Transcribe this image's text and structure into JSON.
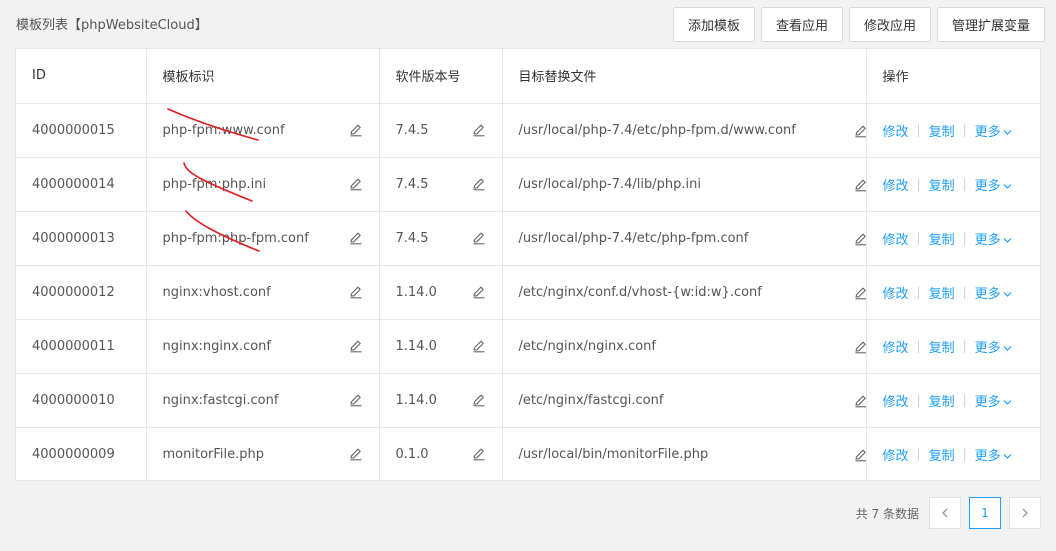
{
  "page": {
    "title": "模板列表【phpWebsiteCloud】"
  },
  "toolbar": {
    "add_template": "添加模板",
    "view_app": "查看应用",
    "edit_app": "修改应用",
    "manage_vars": "管理扩展变量"
  },
  "table": {
    "headers": {
      "id": "ID",
      "template": "模板标识",
      "version": "软件版本号",
      "target_file": "目标替换文件",
      "actions": "操作"
    },
    "rows": [
      {
        "id": "4000000015",
        "template": "php-fpm:www.conf",
        "version": "7.4.5",
        "target_file": "/usr/local/php-7.4/etc/php-fpm.d/www.conf"
      },
      {
        "id": "4000000014",
        "template": "php-fpm:php.ini",
        "version": "7.4.5",
        "target_file": "/usr/local/php-7.4/lib/php.ini"
      },
      {
        "id": "4000000013",
        "template": "php-fpm:php-fpm.conf",
        "version": "7.4.5",
        "target_file": "/usr/local/php-7.4/etc/php-fpm.conf"
      },
      {
        "id": "4000000012",
        "template": "nginx:vhost.conf",
        "version": "1.14.0",
        "target_file": "/etc/nginx/conf.d/vhost-{w:id:w}.conf"
      },
      {
        "id": "4000000011",
        "template": "nginx:nginx.conf",
        "version": "1.14.0",
        "target_file": "/etc/nginx/nginx.conf"
      },
      {
        "id": "4000000010",
        "template": "nginx:fastcgi.conf",
        "version": "1.14.0",
        "target_file": "/etc/nginx/fastcgi.conf"
      },
      {
        "id": "4000000009",
        "template": "monitorFile.php",
        "version": "0.1.0",
        "target_file": "/usr/local/bin/monitorFile.php"
      }
    ],
    "actions": {
      "edit": "修改",
      "copy": "复制",
      "more": "更多"
    }
  },
  "pagination": {
    "total_text": "共 7 条数据",
    "current_page": "1",
    "prev_icon": "chevron-left-icon",
    "next_icon": "chevron-right-icon"
  },
  "colors": {
    "link": "#1e9fff",
    "annotation": "#e02020",
    "border": "#e6e6e6"
  }
}
